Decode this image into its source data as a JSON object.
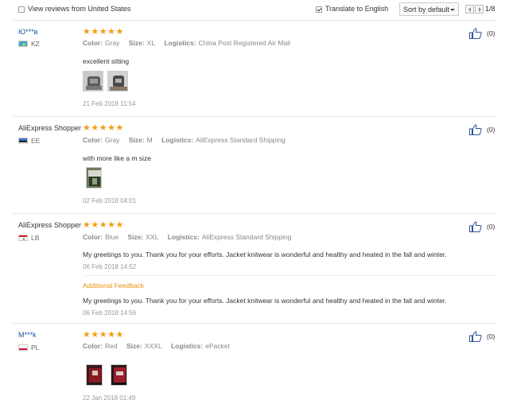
{
  "toolbar": {
    "view_local_label": "View reviews from United States",
    "view_local_checked": false,
    "translate_label": "Translate to English",
    "translate_checked": true,
    "sort_label": "Sort by default",
    "page_indicator": "1/8"
  },
  "reviews": [
    {
      "user": "Ю***в",
      "country": "KZ",
      "rating": 5,
      "color_key": "Color:",
      "color": "Gray",
      "size_key": "Size:",
      "size": "XL",
      "logistics_key": "Logistics:",
      "logistics": "China Post Registered Air Mail",
      "text": "excellent sitting",
      "photos": [
        "review photo 1",
        "review photo 2"
      ],
      "date": "21 Feb 2018 11:54",
      "likes": "(0)"
    },
    {
      "user": "AliExpress Shopper",
      "country": "EE",
      "rating": 5,
      "color_key": "Color:",
      "color": "Gray",
      "size_key": "Size:",
      "size": "M",
      "logistics_key": "Logistics:",
      "logistics": "AliExpress Standard Shipping",
      "text": "with more like a m size",
      "photos": [
        "review photo 1"
      ],
      "date": "02 Feb 2018 04:01",
      "likes": "(0)"
    },
    {
      "user": "AliExpress Shopper",
      "country": "LB",
      "rating": 5,
      "color_key": "Color:",
      "color": "Blue",
      "size_key": "Size:",
      "size": "XXL",
      "logistics_key": "Logistics:",
      "logistics": "AliExpress Standard Shipping",
      "text": "My greetings to you. Thank you for your efforts. Jacket knitwear is wonderful and healthy and heated in the fall and winter.",
      "date": "06 Feb 2018 14:52",
      "additional_label": "Additional Feedback",
      "additional_text": "My greetings to you. Thank you for your efforts. Jacket knitwear is wonderful and healthy and heated in the fall and winter.",
      "additional_date": "06 Feb 2018 14:56",
      "likes": "(0)"
    },
    {
      "user": "M***k",
      "country": "PL",
      "rating": 5,
      "color_key": "Color:",
      "color": "Red",
      "size_key": "Size:",
      "size": "XXXL",
      "logistics_key": "Logistics:",
      "logistics": "ePacket",
      "photos": [
        "review photo 1",
        "review photo 2"
      ],
      "date": "22 Jan 2018 01:49",
      "likes": "(0)"
    }
  ],
  "colors": {
    "star": "#f39c12",
    "link": "#1a55a8",
    "additional_feedback": "#e8900b",
    "like_icon": "#2f5496"
  }
}
